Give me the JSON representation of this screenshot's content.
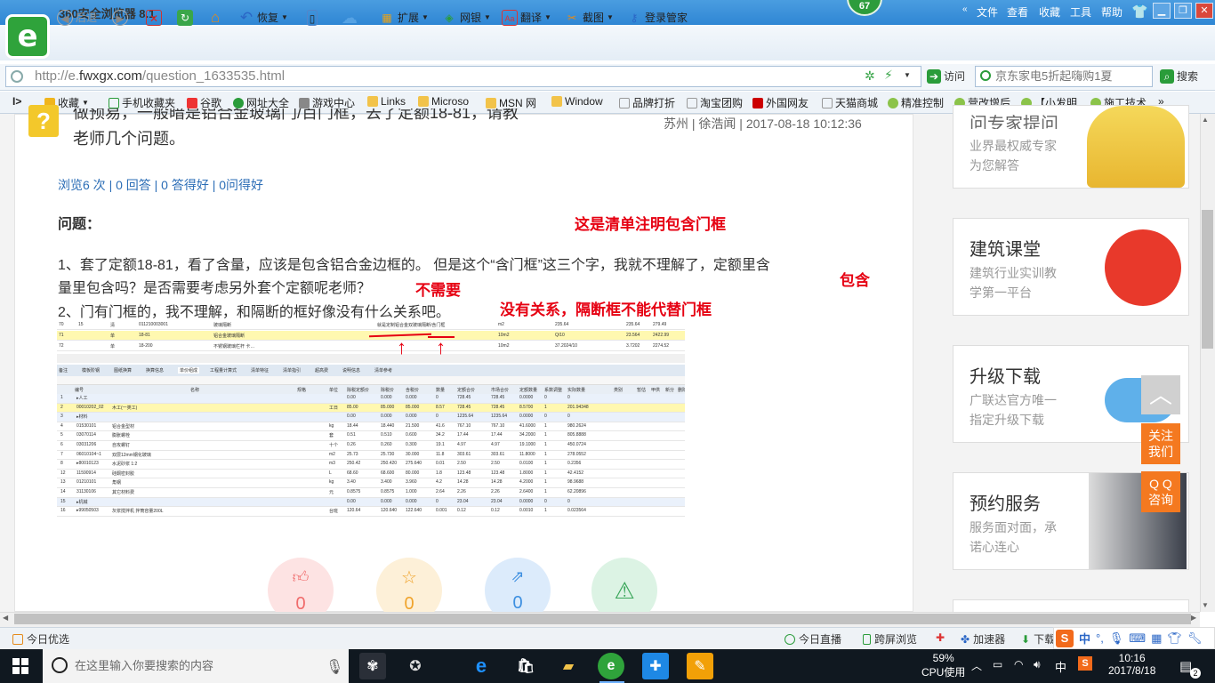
{
  "browser": {
    "title": "360安全浏览器 8.1",
    "badge": "67",
    "menus": [
      "文件",
      "查看",
      "收藏",
      "工具",
      "帮助"
    ],
    "logo": "e"
  },
  "toolbar": {
    "back": "后退",
    "restore": "恢复",
    "extend": "扩展",
    "bank": "网银",
    "translate": "翻译",
    "screenshot": "截图",
    "login": "登录管家"
  },
  "address": {
    "url_prefix": "http://e.",
    "url_host": "fwxgx.com",
    "url_path": "/question_1633535.html",
    "visit": "访问",
    "search_placeholder": "京东家电5折起嗨购1夏",
    "search_btn": "搜索"
  },
  "favorites": [
    "收藏",
    "手机收藏夹",
    "谷歌",
    "网址大全",
    "游戏中心",
    "Links",
    "Microso",
    "MSN 网",
    "Window",
    "品牌打折",
    "淘宝团购",
    "外国网友",
    "天猫商城",
    "精准控制",
    "营改增后",
    "【小发明",
    "施工技术"
  ],
  "question": {
    "title_line1": "做预易，一般暗是铝合金玻璃门/百门框，去了定额18-81，请教",
    "title_line2": "老师几个问题。",
    "meta": "苏州 | 徐浩闻 | 2017-08-18 10:12:36",
    "stats": "浏览6 次 | 0 回答 | 0 答得好 | 0问得好",
    "label": "问题：",
    "p1": "1、套了定额18-81，看了含量，应该是包含铝合金边框的。 但是这个“含门框”这三个字，我就不理解了，定额里含",
    "p1b": "量里包含吗？是否需要考虑另外套个定额呢老师？",
    "p2": "2、门有门框的，我不理解，和隔断的框好像没有什么关系吧。"
  },
  "annotations": {
    "a1": "这是清单注明包含门框",
    "a2": "包含",
    "a3": "不需要",
    "a4": "没有关系，隔断框不能代替门框"
  },
  "actions": {
    "like": "0",
    "fav": "0",
    "share": "0"
  },
  "sidebar": [
    {
      "title": "问专家提问",
      "desc1": "业界最权威专家",
      "desc2": "为您解答"
    },
    {
      "title": "建筑课堂",
      "desc1": "建筑行业实训教",
      "desc2": "学第一平台"
    },
    {
      "title": "升级下载",
      "desc1": "广联达官方唯一",
      "desc2": "指定升级下载"
    },
    {
      "title": "预约服务",
      "desc1": "服务面对面，承",
      "desc2": "诺心连心"
    }
  ],
  "float": {
    "follow1": "关注",
    "follow2": "我们",
    "qq1": "Q Q",
    "qq2": "咨询"
  },
  "status": {
    "left": "今日优选",
    "live": "今日直播",
    "cross": "跨屏浏览",
    "speed": "加速器",
    "download": "下载"
  },
  "taskbar": {
    "search": "在这里输入你要搜索的内容",
    "cpu": "59%",
    "cpu_label": "CPU使用",
    "ime": "中",
    "time": "10:16",
    "date": "2017/8/18",
    "notify": "2"
  },
  "shot": {
    "top_rows": [
      [
        "70",
        "15",
        "清",
        "011210003001",
        "",
        "玻璃隔断",
        "",
        "就是定制铝合金双玻璃隔断/含门框",
        "",
        "m2",
        "235.64",
        "",
        "235.64",
        "279.49"
      ],
      [
        "71",
        "",
        "单",
        "18-81",
        "",
        "铝合金玻璃隔断",
        "",
        "",
        "",
        "10m2",
        "Q/10",
        "",
        "23.564",
        "2422.99"
      ],
      [
        "72",
        "",
        "单",
        "18-200",
        "",
        "不锈钢玻璃栏杆 卡…",
        "",
        "",
        "",
        "10m2",
        "37.2024/10",
        "",
        "3.7202",
        "2274.52"
      ]
    ],
    "tabs": [
      "备注",
      "模板阶钢",
      "图纸换算",
      "换算信息",
      "单价组成",
      "工程量计算式",
      "清单特征",
      "清单指引",
      "超高费",
      "说明信息",
      "清单参考"
    ],
    "headers": [
      "编号",
      "名称",
      "规格",
      "单位",
      "除税定额价",
      "除税价",
      "含税价",
      "数量",
      "定额合价",
      "市场合价",
      "定额数量",
      "系数调整",
      "实际数量",
      "类别",
      "暂估",
      "甲供",
      "新分",
      "删除"
    ],
    "rows": [
      [
        "1",
        "▸人工",
        "",
        "",
        "0.00",
        "0.000",
        "0.000",
        "0",
        "728.45",
        "728.45",
        "0.0000",
        "0",
        "0"
      ],
      [
        "2",
        "00010202_02",
        "木工(一类工)",
        "工日",
        "85.00",
        "85.000",
        "85.000",
        "8.57",
        "728.45",
        "728.45",
        "8.5700",
        "1",
        "201.94348"
      ],
      [
        "3",
        "▸材料",
        "",
        "",
        "0.00",
        "0.000",
        "0.000",
        "0",
        "1235.64",
        "1235.64",
        "0.0000",
        "0",
        "0"
      ],
      [
        "4",
        "01530101",
        "铝合金型材",
        "kg",
        "18.44",
        "18.440",
        "21.500",
        "41.6",
        "767.10",
        "767.10",
        "41.6000",
        "1",
        "980.2624"
      ],
      [
        "5",
        "03070114",
        "膨胀螺栓",
        "套",
        "0.51",
        "0.510",
        "0.600",
        "34.2",
        "17.44",
        "17.44",
        "34.2000",
        "1",
        "805.8888"
      ],
      [
        "6",
        "03031206",
        "自攻螺钉",
        "十个",
        "0.26",
        "0.260",
        "0.300",
        "19.1",
        "4.97",
        "4.97",
        "19.1000",
        "1",
        "450.0724"
      ],
      [
        "7",
        "06010104~1",
        "双层12mm钢化玻璃",
        "m2",
        "25.73",
        "25.730",
        "30.000",
        "11.8",
        "303.61",
        "303.61",
        "11.8000",
        "1",
        "278.0552"
      ],
      [
        "8",
        "▸80010123",
        "水泥砂浆 1:2",
        "m3",
        "250.42",
        "250.420",
        "275.640",
        "0.01",
        "2.50",
        "2.50",
        "0.0100",
        "1",
        "0.2356"
      ],
      [
        "12",
        "11590914",
        "硅酮密封胶",
        "L",
        "68.60",
        "68.600",
        "80.000",
        "1.8",
        "123.48",
        "123.48",
        "1.8000",
        "1",
        "42.4152"
      ],
      [
        "13",
        "01210101",
        "角钢",
        "kg",
        "3.40",
        "3.400",
        "3.960",
        "4.2",
        "14.28",
        "14.28",
        "4.2000",
        "1",
        "98.9688"
      ],
      [
        "14",
        "31130106",
        "其它材料费",
        "元",
        "0.8575",
        "0.8575",
        "1.000",
        "2.64",
        "2.26",
        "2.26",
        "2.6400",
        "1",
        "62.20896"
      ],
      [
        "15",
        "▸机械",
        "",
        "",
        "0.00",
        "0.000",
        "0.000",
        "0",
        "23.04",
        "23.04",
        "0.0000",
        "0",
        "0"
      ],
      [
        "16",
        "▸99050503",
        "灰浆搅拌机 拌筒容量200L",
        "台班",
        "120.64",
        "120.640",
        "122.640",
        "0.001",
        "0.12",
        "0.12",
        "0.0010",
        "1",
        "0.023564"
      ]
    ]
  }
}
